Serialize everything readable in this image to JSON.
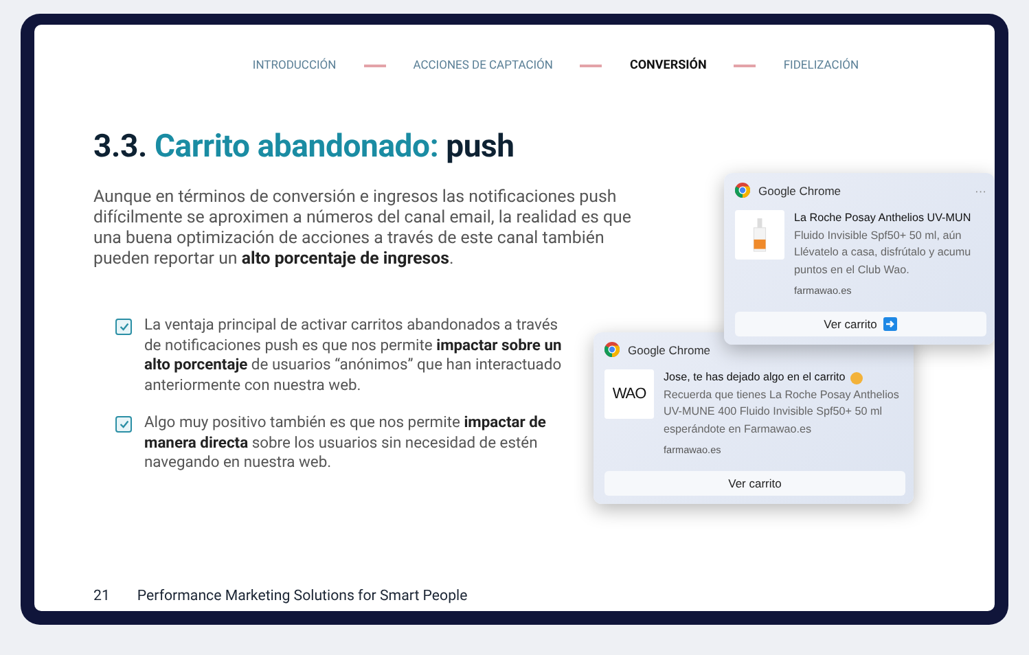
{
  "steps": [
    {
      "label": "INTRODUCCIÓN",
      "selected": false
    },
    {
      "label": "ACCIONES DE CAPTACIÓN",
      "selected": false
    },
    {
      "label": "CONVERSIÓN",
      "selected": true
    },
    {
      "label": "FIDELIZACIÓN",
      "selected": false
    }
  ],
  "title": {
    "number": "3.3.",
    "highlight": "Carrito abandonado:",
    "rest": "push"
  },
  "intro": "Aunque en términos de conversión e ingresos las notificaciones push difícilmente se aproximen a números del canal email, la realidad es que una buena optimización de acciones a través de este canal también pueden reportar un **alto porcentaje de ingresos**.",
  "checklist": [
    {
      "text": "La ventaja principal de activar carritos abandonados a través de notificaciones push es que nos permite **impactar sobre un alto porcentaje** de usuarios “anónimos” que han interactuado anteriormente con nuestra web.",
      "checked": true
    },
    {
      "text": "Algo muy positivo también es que nos permite **impactar de manera directa** sobre los usuarios sin necesidad de estén navegando en nuestra web.",
      "checked": true
    }
  ],
  "notifications": [
    {
      "app": "Google Chrome",
      "menu": "···",
      "title": "La Roche Posay Anthelios UV-MUN",
      "lines": [
        "Fluido Invisible Spf50+ 50 ml, aún",
        "Llévatelo a casa, disfrútalo y acumu",
        "puntos en el Club Wao."
      ],
      "site": "farmawao.es",
      "button": "Ver carrito",
      "button_arrow": true,
      "emoji": false
    },
    {
      "app": "Google Chrome",
      "logo": "WAO",
      "title": "Jose, te has dejado algo en el carrito",
      "emoji": true,
      "lines": [
        "Recuerda que tienes La Roche Posay Anthelios UV-MUNE 400 Fluido Invisible Spf50+ 50 ml esperándote en Farmawao.es"
      ],
      "site": "farmawao.es",
      "button": "Ver carrito",
      "button_arrow": false
    }
  ],
  "footer": {
    "page": "21",
    "text": "Performance Marketing Solutions for Smart People"
  }
}
